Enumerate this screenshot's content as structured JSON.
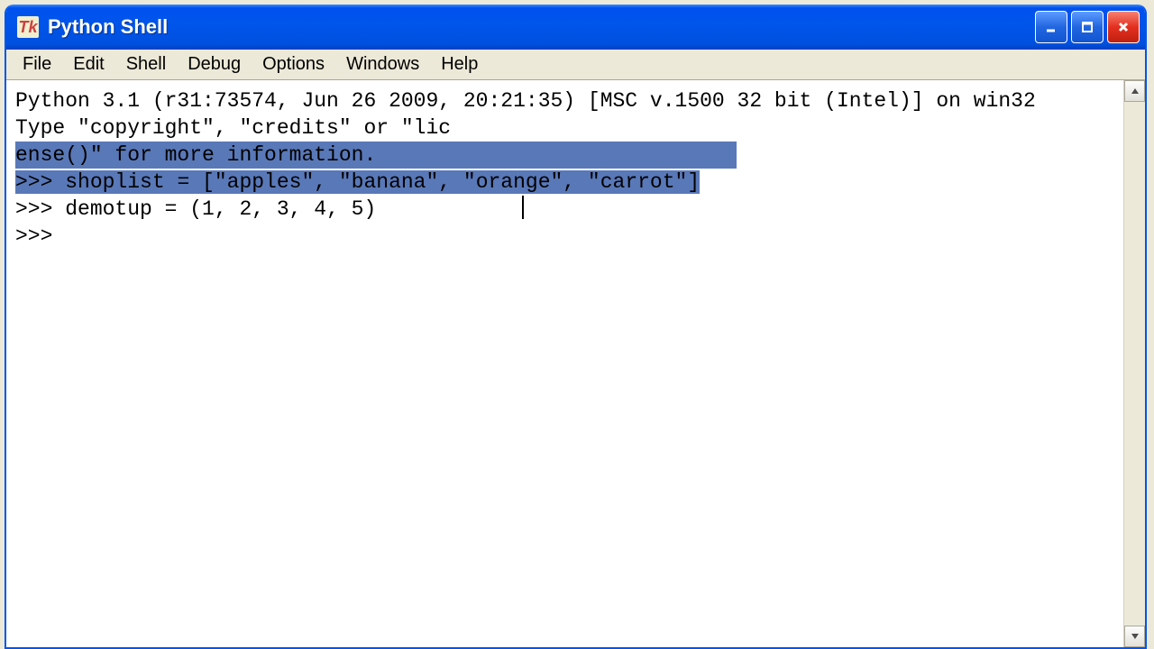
{
  "window": {
    "title": "Python Shell",
    "icon_glyph": "Tk"
  },
  "menubar": {
    "items": [
      "File",
      "Edit",
      "Shell",
      "Debug",
      "Options",
      "Windows",
      "Help"
    ]
  },
  "terminal": {
    "banner_line": "Python 3.1 (r31:73574, Jun 26 2009, 20:21:35) [MSC v.1500 32 bit (Intel)] on win32",
    "info_prefix": "Type \"copyright\", \"credits\" or \"lic",
    "info_highlighted": "ense()\" for more information.",
    "prompt1": ">>> ",
    "line1_code": "shoplist = [\"apples\", \"banana\", \"orange\", \"carrot\"]",
    "prompt2": ">>> ",
    "line2_code": "demotup = (1, 2, 3, 4, 5)",
    "prompt3": ">>> "
  }
}
